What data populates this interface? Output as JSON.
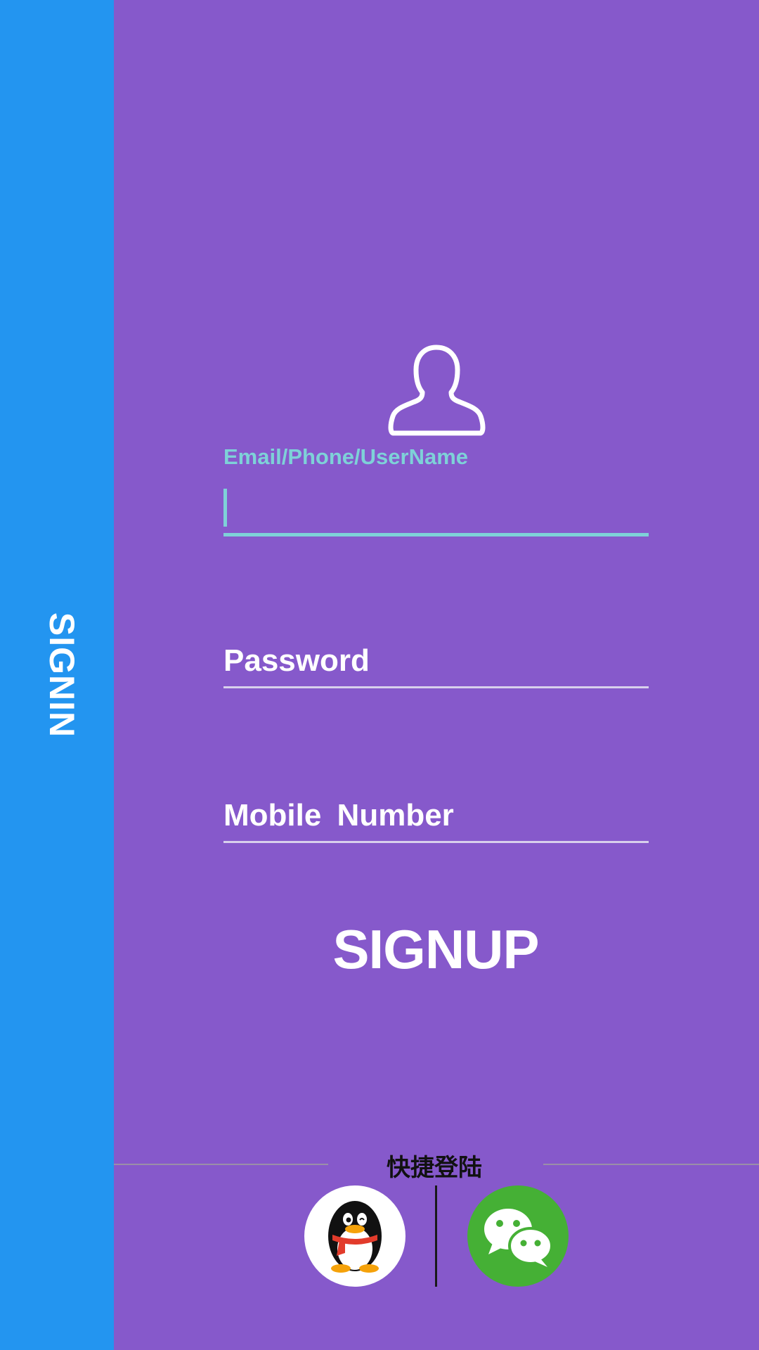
{
  "side_tab": {
    "label": "SIGNIN"
  },
  "form": {
    "username_label": "Email/Phone/UserName",
    "password_label": "Password",
    "mobile_label": "Mobile Number",
    "submit_label": "SIGNUP"
  },
  "quick_login": {
    "title": "快捷登陆"
  },
  "colors": {
    "background": "#8659CB",
    "side_strip": "#2395F0",
    "accent_teal": "#7ED1D8",
    "wechat_green": "#45B035"
  },
  "icons": {
    "avatar": "user-silhouette-icon",
    "qq": "qq-penguin-icon",
    "wechat": "wechat-bubbles-icon"
  }
}
